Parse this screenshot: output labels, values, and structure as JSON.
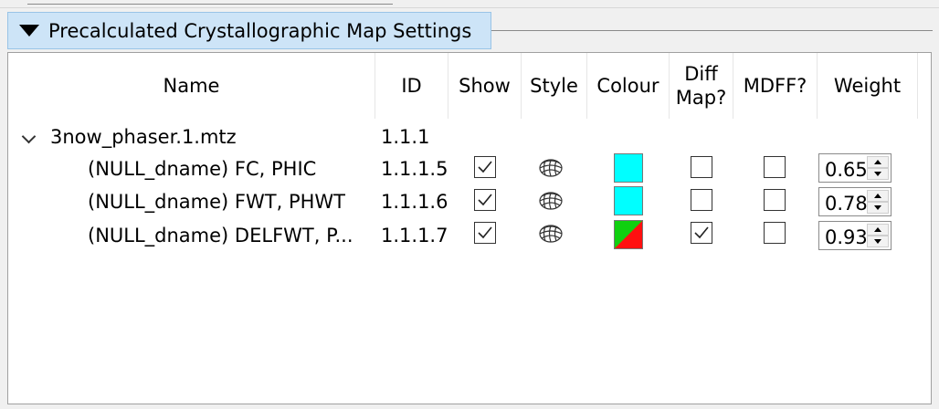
{
  "group": {
    "title": "Precalculated Crystallographic Map Settings"
  },
  "columns": {
    "name": "Name",
    "id": "ID",
    "show": "Show",
    "style": "Style",
    "colour": "Colour",
    "diff_line1": "Diff",
    "diff_line2": "Map?",
    "mdff": "MDFF?",
    "weight": "Weight"
  },
  "parent": {
    "name": "3now_phaser.1.mtz",
    "id": "1.1.1"
  },
  "rows": [
    {
      "name": "(NULL_dname) FC, PHIC",
      "id": "1.1.1.5",
      "show": true,
      "style_icon": "mesh-icon",
      "colour": "#00ffff",
      "diff": false,
      "mdff": false,
      "weight": "0.650"
    },
    {
      "name": "(NULL_dname) FWT, PHWT",
      "id": "1.1.1.6",
      "show": true,
      "style_icon": "mesh-icon",
      "colour": "#00ffff",
      "diff": false,
      "mdff": false,
      "weight": "0.780"
    },
    {
      "name": "(NULL_dname) DELFWT, P...",
      "id": "1.1.1.7",
      "show": true,
      "style_icon": "mesh-icon",
      "colour": "green-red-diagonal",
      "diff": true,
      "mdff": false,
      "weight": "0.930"
    }
  ]
}
